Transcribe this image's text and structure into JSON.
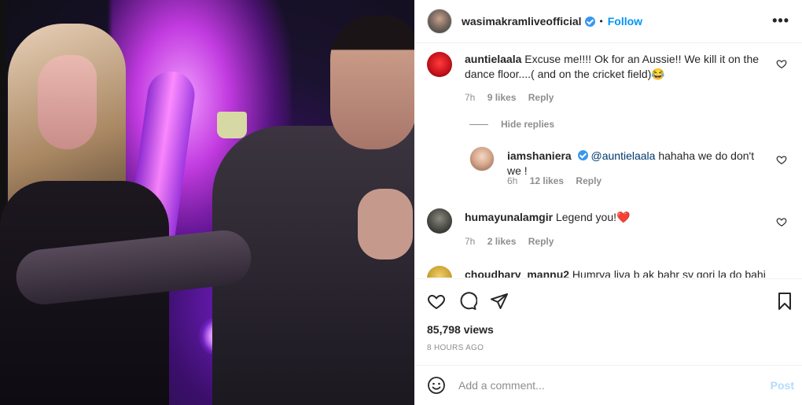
{
  "post": {
    "username": "wasimakramliveofficial",
    "separator": "•",
    "follow_label": "Follow",
    "more_label": "•••"
  },
  "comments": [
    {
      "username": "auntielaala",
      "text": "Excuse me!!!! Ok for an Aussie!! We kill it on the dance floor....( and on the cricket field)😂",
      "time": "7h",
      "likes": "9 likes",
      "reply_label": "Reply",
      "avatar_color": "#e0242b"
    },
    {
      "username": "iamshaniera",
      "mention": "@auntielaala",
      "text": " hahaha we do don't we !",
      "time": "6h",
      "likes": "12 likes",
      "reply_label": "Reply",
      "avatar_color": "#e9c9b4"
    },
    {
      "username": "humayunalamgir",
      "text": "Legend you!❤️",
      "time": "7h",
      "likes": "2 likes",
      "reply_label": "Reply",
      "avatar_color": "#4a4a44"
    },
    {
      "username": "choudhary_mannu2",
      "text": "Humrya liya b ak bahr sy gori la do bahi",
      "avatar_color": "#c9a232"
    }
  ],
  "hide_replies_label": "Hide replies",
  "actions": {
    "views": "85,798 views",
    "time_ago": "8 HOURS AGO"
  },
  "add_comment": {
    "placeholder": "Add a comment...",
    "post_label": "Post"
  },
  "colors": {
    "accent": "#0095f6",
    "post_disabled": "#b3dbff",
    "muted": "#8e8e8e"
  }
}
